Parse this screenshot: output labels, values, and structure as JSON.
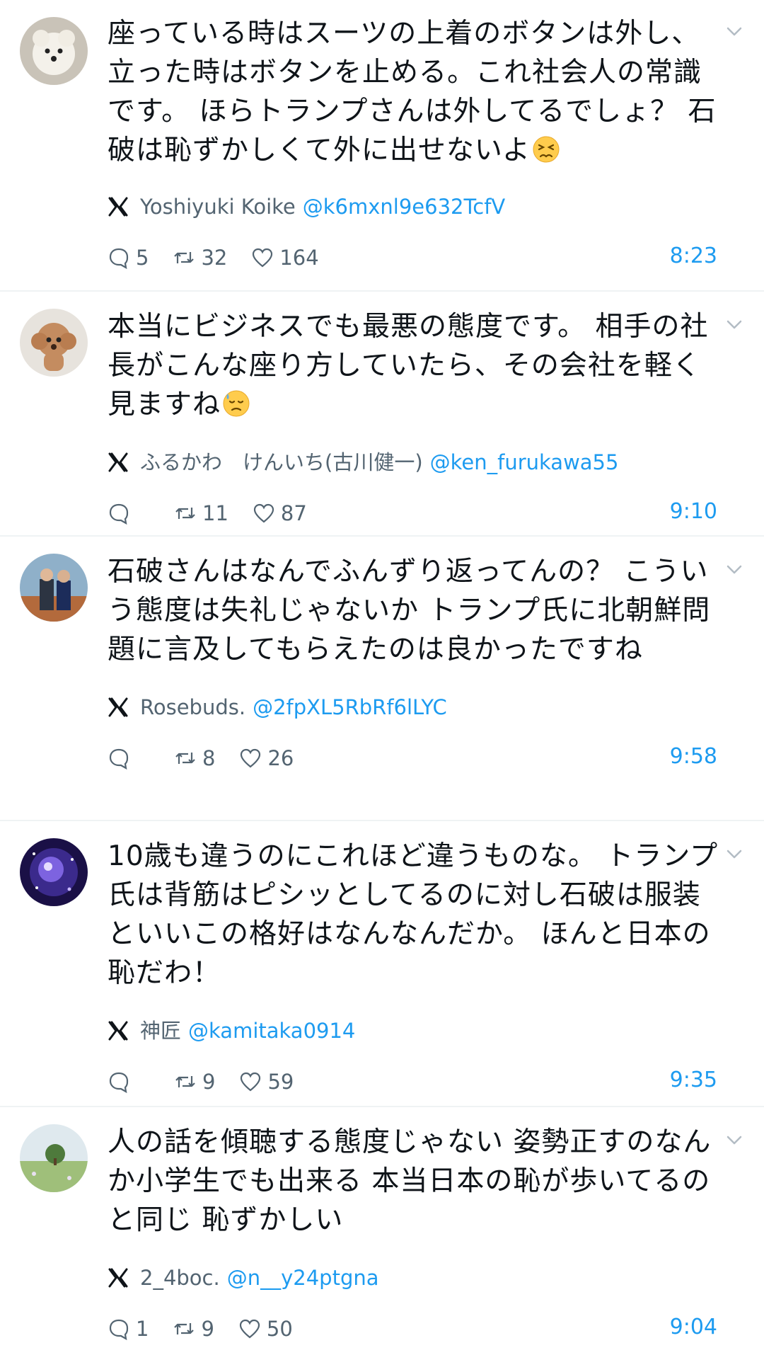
{
  "tweets": [
    {
      "text": "座っている時はスーツの上着のボタンは外し、立った時はボタンを止める。これ社会人の常識です。 ほらトランプさんは外してるでしょ？ 石破は恥ずかしくて外に出せないよ",
      "emoji": "persevering-face",
      "author_name": "Yoshiyuki Koike",
      "author_handle": "@k6mxnl9e632TcfV",
      "replies": "5",
      "retweets": "32",
      "likes": "164",
      "time": "8:23",
      "avatar": "white-dog-avatar"
    },
    {
      "text": "本当にビジネスでも最悪の態度です。 相手の社長がこんな座り方していたら、その会社を軽く見ますね",
      "emoji": "downcast-sweat-face",
      "author_name": "ふるかわ　けんいち(古川健一)",
      "author_handle": "@ken_furukawa55",
      "replies": "",
      "retweets": "11",
      "likes": "87",
      "time": "9:10",
      "avatar": "poodle-avatar"
    },
    {
      "text": "石破さんはなんでふんずり返ってんの？ こういう態度は失礼じゃないか トランプ氏に北朝鮮問題に言及してもらえたのは良かったですね",
      "emoji": "",
      "author_name": "Rosebuds.",
      "author_handle": "@2fpXL5RbRf6lLYC",
      "replies": "",
      "retweets": "8",
      "likes": "26",
      "time": "9:58",
      "avatar": "people-photo-avatar"
    },
    {
      "text": "10歳も違うのにこれほど違うものな。 トランプ氏は背筋はピシッとしてるのに対し石破は服装といいこの格好はなんなんだか。 ほんと日本の恥だわ！",
      "emoji": "",
      "author_name": "神匠",
      "author_handle": "@kamitaka0914",
      "replies": "",
      "retweets": "9",
      "likes": "59",
      "time": "9:35",
      "avatar": "purple-galaxy-avatar"
    },
    {
      "text": "人の話を傾聴する態度じゃない 姿勢正すのなんか小学生でも出来る 本当日本の恥が歩いてるのと同じ 恥ずかしい",
      "emoji": "",
      "author_name": "2_4boc.",
      "author_handle": "@n__y24ptgna",
      "replies": "1",
      "retweets": "9",
      "likes": "50",
      "time": "9:04",
      "avatar": "landscape-avatar"
    }
  ],
  "colors": {
    "link": "#1d9bf0",
    "muted": "#536471",
    "divider": "#eff3f4",
    "text": "#0f1419"
  }
}
